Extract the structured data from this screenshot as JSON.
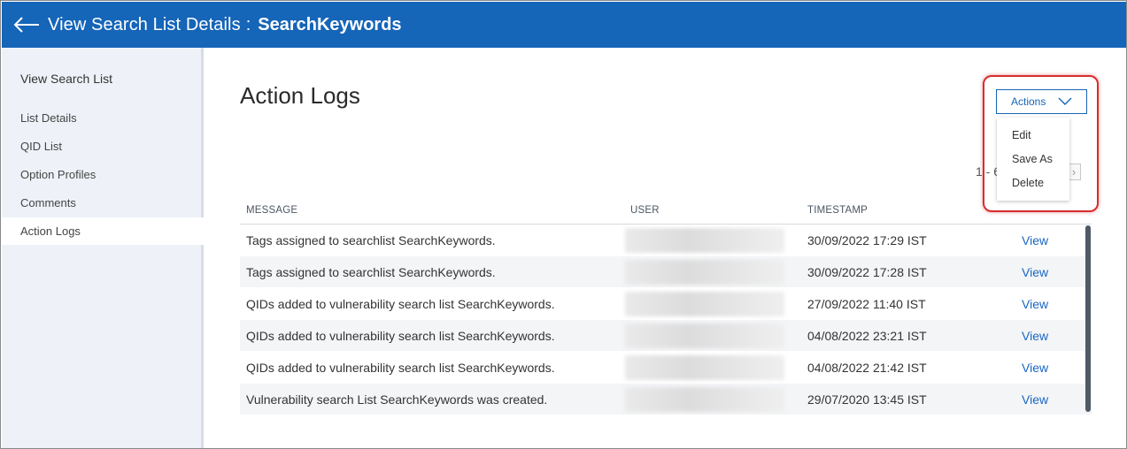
{
  "header": {
    "title_prefix": "View Search List Details",
    "separator": ":",
    "list_name": "SearchKeywords",
    "back_icon": "back-arrow-icon",
    "background_color": "#1565b8"
  },
  "sidebar": {
    "heading": "View Search List",
    "items": [
      {
        "label": "List Details",
        "active": false
      },
      {
        "label": "QID List",
        "active": false
      },
      {
        "label": "Option Profiles",
        "active": false
      },
      {
        "label": "Comments",
        "active": false
      },
      {
        "label": "Action Logs",
        "active": true
      }
    ]
  },
  "main": {
    "title": "Action Logs",
    "pager_text": "1 - 6",
    "pager_next_icon": "chevron-right-icon"
  },
  "actions": {
    "button_label": "Actions",
    "chevron_icon": "chevron-down-icon",
    "menu": [
      {
        "label": "Edit"
      },
      {
        "label": "Save As"
      },
      {
        "label": "Delete"
      }
    ],
    "highlight_color": "#d62e2e"
  },
  "table": {
    "columns": [
      "MESSAGE",
      "USER",
      "TIMESTAMP"
    ],
    "rows": [
      {
        "message": "Tags assigned to searchlist SearchKeywords.",
        "timestamp": "30/09/2022 17:29 IST",
        "link": "View"
      },
      {
        "message": "Tags assigned to searchlist SearchKeywords.",
        "timestamp": "30/09/2022 17:28 IST",
        "link": "View"
      },
      {
        "message": "QIDs added to vulnerability search list SearchKeywords.",
        "timestamp": "27/09/2022 11:40 IST",
        "link": "View"
      },
      {
        "message": "QIDs added to vulnerability search list SearchKeywords.",
        "timestamp": "04/08/2022 23:21 IST",
        "link": "View"
      },
      {
        "message": "QIDs added to vulnerability search list SearchKeywords.",
        "timestamp": "04/08/2022 21:42 IST",
        "link": "View"
      },
      {
        "message": "Vulnerability search List SearchKeywords was created.",
        "timestamp": "29/07/2020 13:45 IST",
        "link": "View"
      }
    ]
  }
}
